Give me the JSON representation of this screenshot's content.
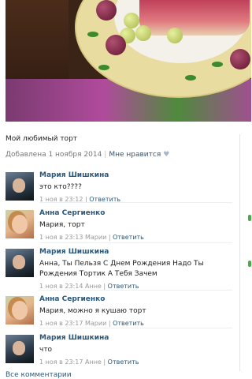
{
  "post": {
    "caption": "Мой любимый торт",
    "added": "Добавлена 1 ноября 2014",
    "like_label": "Мне нравится",
    "heart": "♥"
  },
  "comments": [
    {
      "author": "Мария Шишкина",
      "text": "это кто????",
      "date": "1 ноя в 23:12",
      "to": "",
      "reply": "Ответить",
      "avatar": "man"
    },
    {
      "author": "Анна Сергиенко",
      "text": "Мария, торт",
      "date": "1 ноя в 23:13",
      "to": "Марии",
      "reply": "Ответить",
      "avatar": "woman"
    },
    {
      "author": "Мария Шишкина",
      "text": "Анна, Ты Пельзя С Днем Рождения Надо Ты Рождения Тортик А Тебя Зачем",
      "date": "1 ноя в 23:14",
      "to": "Анне",
      "reply": "Ответить",
      "avatar": "man"
    },
    {
      "author": "Анна Сергиенко",
      "text": "Мария, можно я кушаю торт",
      "date": "1 ноя в 23:17",
      "to": "Марии",
      "reply": "Ответить",
      "avatar": "woman"
    },
    {
      "author": "Мария Шишкина",
      "text": "что",
      "date": "1 ноя в 23:17",
      "to": "Анне",
      "reply": "Ответить",
      "avatar": "man"
    }
  ],
  "footer": {
    "all_comments": "Все комментарии"
  },
  "colors": {
    "link": "#2b587a",
    "meta": "#999999",
    "online": "#4ca84c"
  }
}
